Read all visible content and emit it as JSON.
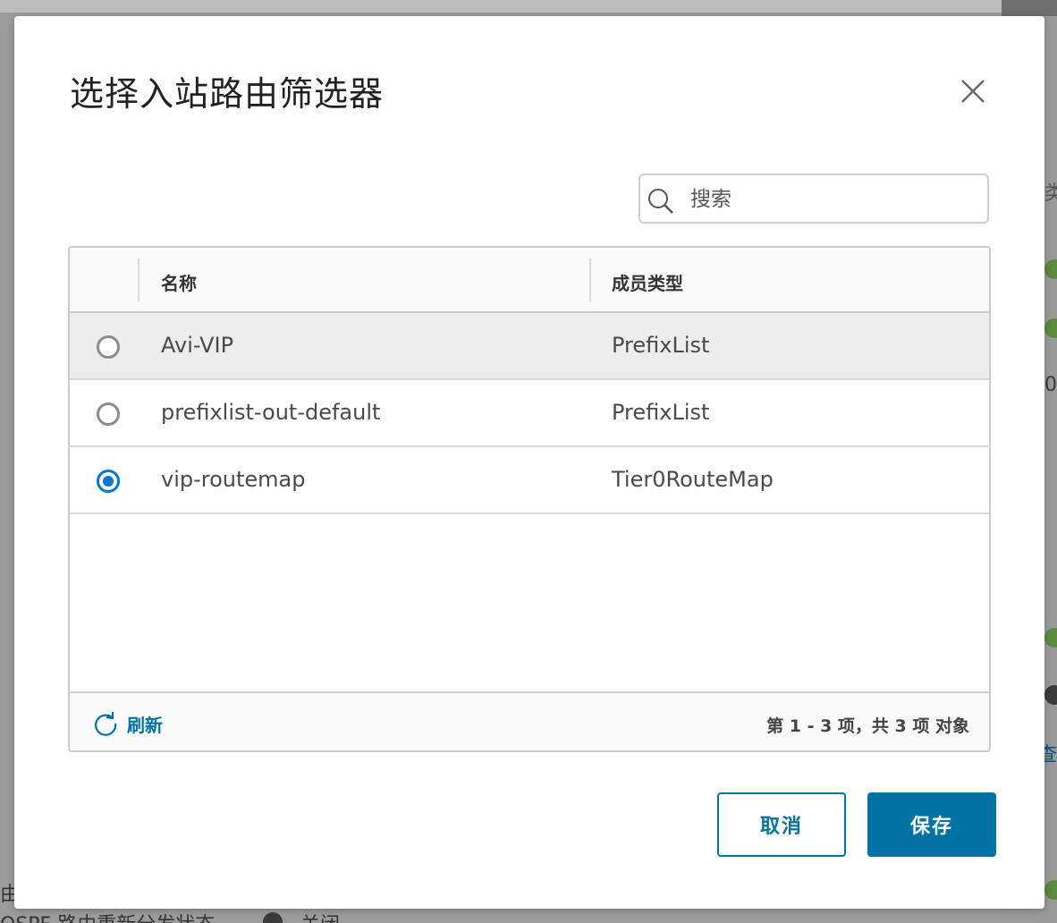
{
  "background": {
    "bottom_text": "OSPF 路由重新分发状态",
    "bottom_status": "关闭",
    "right_fragment_1": "类",
    "right_fragment_2": "0",
    "right_fragment_3": "查看",
    "left_fragment": "由"
  },
  "modal": {
    "title": "选择入站路由筛选器",
    "close_icon": "close-icon",
    "search": {
      "placeholder": "搜索",
      "value": ""
    },
    "grid": {
      "columns": [
        "名称",
        "成员类型"
      ],
      "rows": [
        {
          "name": "Avi-VIP",
          "member_type": "PrefixList",
          "selected": false,
          "highlighted": true
        },
        {
          "name": "prefixlist-out-default",
          "member_type": "PrefixList",
          "selected": false,
          "highlighted": false
        },
        {
          "name": "vip-routemap",
          "member_type": "Tier0RouteMap",
          "selected": true,
          "highlighted": false
        }
      ],
      "footer": {
        "refresh_label": "刷新",
        "pagination": "第 1 - 3 项，共 3 项 对象"
      }
    },
    "buttons": {
      "cancel": "取消",
      "save": "保存"
    }
  },
  "colors": {
    "accent": "#0072a3",
    "radio_selected": "#0079d3",
    "radio_unselected": "#8c8c8c",
    "row_highlight": "#ededed"
  }
}
